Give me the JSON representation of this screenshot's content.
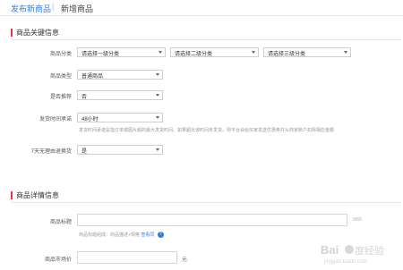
{
  "breadcrumb": {
    "link": "发布新商品",
    "separator": "|",
    "current": "新增商品"
  },
  "section1": {
    "title": "商品关键信息"
  },
  "category": {
    "label": "商品分类",
    "level1": "请选择一级分类",
    "level2": "请选择二级分类",
    "level3": "请选择三级分类"
  },
  "product_type": {
    "label": "商品类型",
    "value": "普通商品"
  },
  "recommend": {
    "label": "是否推荐",
    "value": "否"
  },
  "ship_time": {
    "label": "发货时间承诺",
    "value": "48小时",
    "hint": "发货时间承诺是指订单或图片超的最大发货时间。如果超出该时间未发货，则平台会给买家发送优惠券并从商家账户扣除相应金额"
  },
  "return_policy": {
    "label": "7天无理由退换货",
    "value": "是"
  },
  "section2": {
    "title": "商品详情信息"
  },
  "title_field": {
    "label": "商品标题",
    "counter": "0/60",
    "hint_prefix": "商品标题组成：商品描述+规格",
    "hint_link": "查看同",
    "help_icon": "?"
  },
  "price_field": {
    "label": "商品市场价",
    "unit": "元"
  },
  "watermark": {
    "text": "Bai度经验",
    "sub": "jingyan.baidu.com"
  },
  "colors": {
    "accent": "#e4393c",
    "link": "#3a7bd5"
  }
}
